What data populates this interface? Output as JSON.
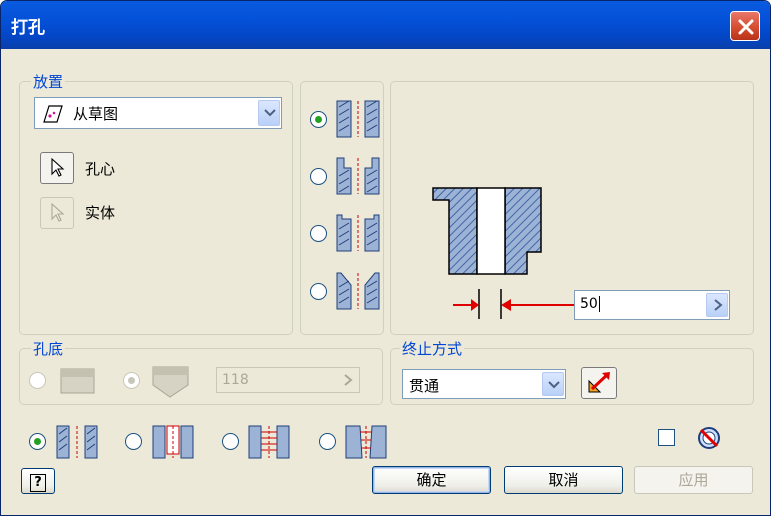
{
  "window": {
    "title": "打孔"
  },
  "placement": {
    "group_label": "放置",
    "mode_value": "从草图",
    "center_label": "孔心",
    "solid_label": "实体"
  },
  "bottom": {
    "group_label": "孔底",
    "angle_value": "118"
  },
  "termination": {
    "group_label": "终止方式",
    "value": "贯通"
  },
  "preview": {
    "diameter_value": "50"
  },
  "buttons": {
    "ok": "确定",
    "cancel": "取消",
    "apply": "应用",
    "help": "?"
  },
  "colors": {
    "accent": "#0046d5",
    "dimension_arrow": "#e00000",
    "hatch": "#5a7fb4"
  }
}
